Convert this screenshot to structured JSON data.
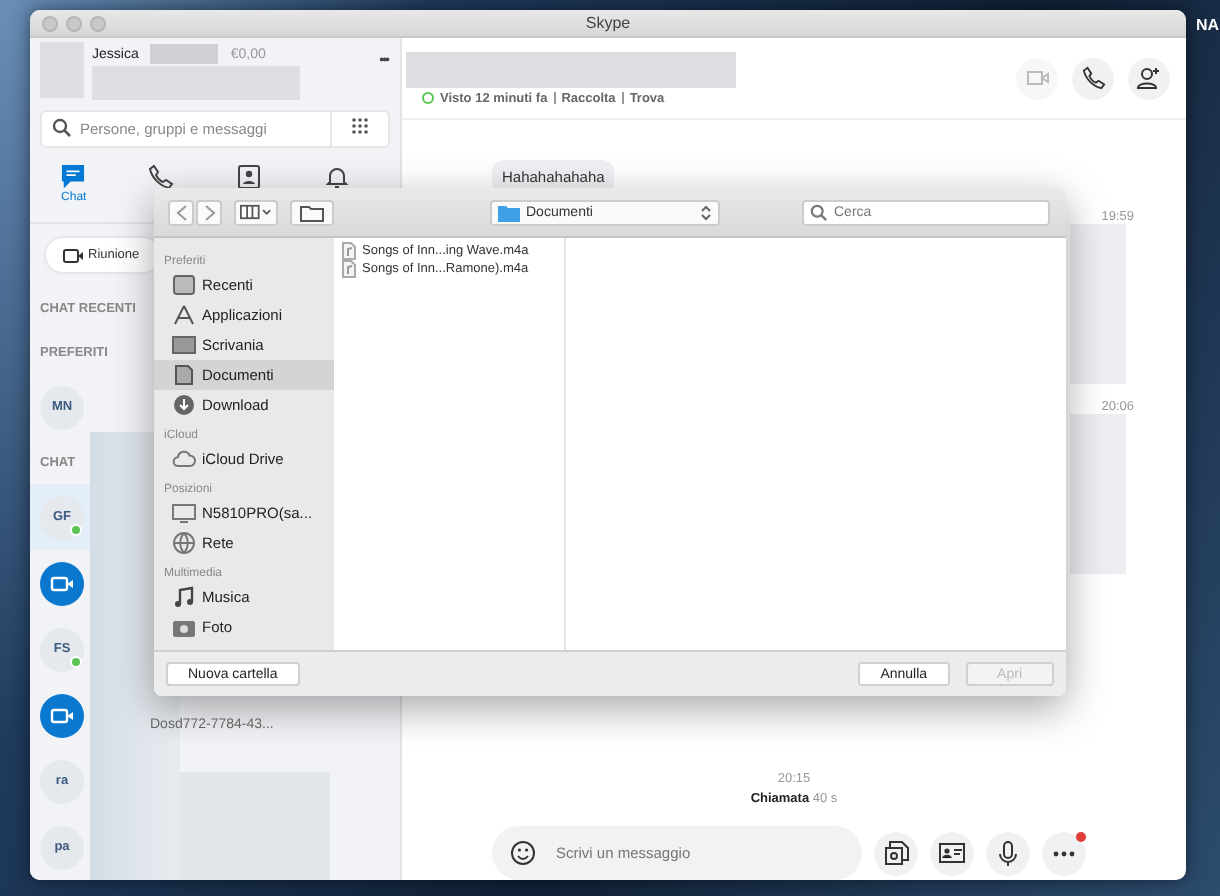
{
  "desktop": {
    "corner_text": "NA"
  },
  "window": {
    "title": "Skype"
  },
  "profile": {
    "name": "Jessica",
    "credit": "€0,00",
    "menu": "•••"
  },
  "search": {
    "placeholder": "Persone, gruppi e messaggi"
  },
  "nav": [
    {
      "kind": "chat",
      "label": "Chat",
      "selected": true
    },
    {
      "kind": "phone",
      "selected": false
    },
    {
      "kind": "contacts",
      "selected": false
    },
    {
      "kind": "bell",
      "selected": false
    }
  ],
  "meeting_button": {
    "label": "Riunione"
  },
  "contacts": [
    {
      "kind": "header",
      "label": "CHAT RECENTI"
    },
    {
      "kind": "header",
      "label": "PREFERITI"
    },
    {
      "kind": "avatar",
      "initials": "MN",
      "online": false,
      "selected": false
    },
    {
      "kind": "header",
      "label": "CHAT"
    },
    {
      "kind": "avatar",
      "initials": "GF",
      "online": true,
      "selected": true
    },
    {
      "kind": "meeting",
      "selected": false
    },
    {
      "kind": "avatar",
      "initials": "FS",
      "online": true,
      "selected": false
    },
    {
      "kind": "meeting",
      "preview": "Dosd772-7784-43...",
      "selected": false
    },
    {
      "kind": "avatar",
      "initials": "ra",
      "online": false,
      "selected": false
    },
    {
      "kind": "avatar",
      "initials": "pa",
      "online": false,
      "selected": false
    }
  ],
  "chat_header": {
    "status": "Visto 12 minuti fa",
    "links": [
      "Raccolta",
      "Trova"
    ],
    "buttons": [
      {
        "kind": "video",
        "disabled": true
      },
      {
        "kind": "call",
        "disabled": false
      },
      {
        "kind": "add-person",
        "disabled": false
      }
    ]
  },
  "messages": [
    {
      "kind": "bubble",
      "text": "Hahahahahaha"
    },
    {
      "kind": "time",
      "text": "19:59"
    },
    {
      "kind": "block"
    },
    {
      "kind": "time",
      "text": "20:06"
    },
    {
      "kind": "block"
    }
  ],
  "call_log": {
    "time": "20:15",
    "label": "Chiamata",
    "duration": "40 s"
  },
  "composer": {
    "placeholder": "Scrivi un messaggio",
    "actions": [
      {
        "kind": "media",
        "badge": false
      },
      {
        "kind": "card",
        "badge": false
      },
      {
        "kind": "mic",
        "badge": false
      },
      {
        "kind": "more",
        "badge": true
      }
    ]
  },
  "dialog": {
    "location": "Documenti",
    "search_placeholder": "Cerca",
    "sidebar": [
      {
        "title": "Preferiti",
        "items": [
          {
            "kind": "clock",
            "label": "Recenti",
            "selected": false
          },
          {
            "kind": "apps",
            "label": "Applicazioni",
            "selected": false
          },
          {
            "kind": "desktop",
            "label": "Scrivania",
            "selected": false
          },
          {
            "kind": "docs",
            "label": "Documenti",
            "selected": true
          },
          {
            "kind": "download",
            "label": "Download",
            "selected": false
          }
        ]
      },
      {
        "title": "iCloud",
        "items": [
          {
            "kind": "cloud",
            "label": "iCloud Drive",
            "selected": false
          }
        ]
      },
      {
        "title": "Posizioni",
        "items": [
          {
            "kind": "computer",
            "label": "N5810PRO(sa...",
            "selected": false
          },
          {
            "kind": "network",
            "label": "Rete",
            "selected": false
          }
        ]
      },
      {
        "title": "Multimedia",
        "items": [
          {
            "kind": "music",
            "label": "Musica",
            "selected": false
          },
          {
            "kind": "camera",
            "label": "Foto",
            "selected": false
          }
        ]
      }
    ],
    "files": [
      {
        "name": "Songs of Inn...ing Wave.m4a",
        "selected": false
      },
      {
        "name": "Songs of Inn...Ramone).m4a",
        "selected": false
      }
    ],
    "new_folder": "Nuova cartella",
    "cancel": "Annulla",
    "open": {
      "label": "Apri",
      "disabled": true
    }
  }
}
